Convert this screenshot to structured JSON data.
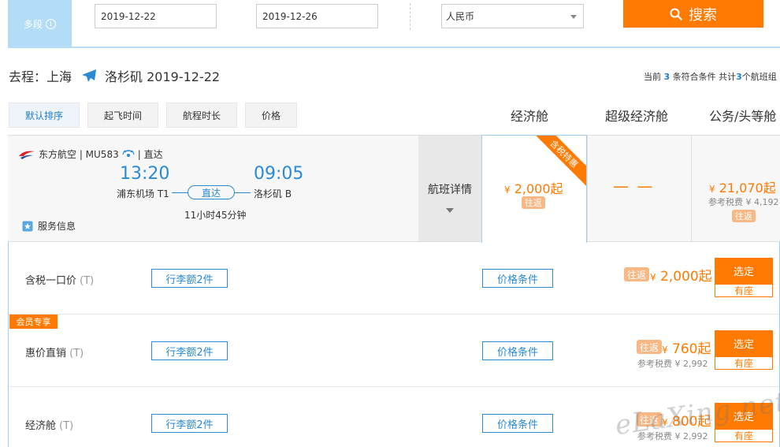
{
  "search": {
    "multi_segment_label": "多段",
    "depart_date": "2019-12-22",
    "return_date": "2019-12-26",
    "currency": "人民币",
    "search_label": "搜索"
  },
  "route": {
    "prefix": "去程：上海",
    "destination_date": "洛杉矶 2019-12-22"
  },
  "summary": {
    "before": "当前 ",
    "count": "3",
    "middle": " 条符合条件 共计",
    "total": "3",
    "after": "个航班组"
  },
  "sort_tabs": [
    "默认排序",
    "起飞时间",
    "航程时长",
    "价格"
  ],
  "cabins": {
    "economy": "经济舱",
    "super_economy": "超级经济舱",
    "business": "公务/头等舱"
  },
  "flight": {
    "airline": "东方航空 | MU583",
    "direct": "| 直达",
    "depart_time": "13:20",
    "arrive_time": "09:05",
    "depart_airport": "浦东机场 T1",
    "arrive_airport": "洛杉矶 B",
    "direct_pill": "直达",
    "duration": "11小时45分钟",
    "service": "服务信息",
    "details": "航班详情",
    "ribbon": "含税特惠",
    "economy_price": "2,000起",
    "roundtrip_tag": "往返",
    "super_economy_price": "— —",
    "business_price": "21,070起",
    "business_tax": "参考税费 ¥ 4,192",
    "yen": "¥"
  },
  "fares": [
    {
      "name": "含税一口价",
      "t": "(T)",
      "baggage": "行李额2件",
      "conditions": "价格条件",
      "tag": "往返",
      "price": "2,000起",
      "tax": "",
      "select": "选定",
      "seat": "有座"
    },
    {
      "name": "惠价直销",
      "t": "(T)",
      "baggage": "行李额2件",
      "conditions": "价格条件",
      "tag": "往返",
      "price": "760起",
      "tax": "参考税费 ¥ 2,992",
      "select": "选定",
      "seat": "有座",
      "member": "会员专享"
    },
    {
      "name": "经济舱",
      "t": "(T)",
      "baggage": "行李额2件",
      "conditions": "价格条件",
      "tag": "往返",
      "price": "800起",
      "tax": "参考税费 ¥ 2,992",
      "select": "选定",
      "seat": "有座"
    }
  ],
  "watermark": "eLaXing.net",
  "colors": {
    "accent": "#ff7a00",
    "blue": "#2a8ad4",
    "light_blue": "#b3dcf6"
  }
}
